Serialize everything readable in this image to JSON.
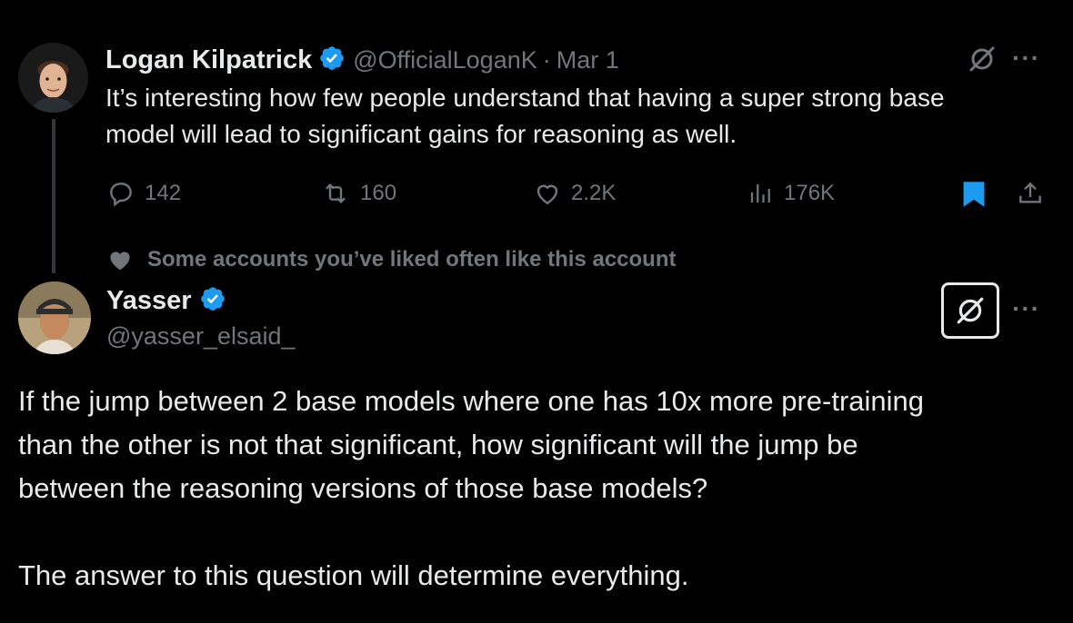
{
  "tweet": {
    "author_name": "Logan Kilpatrick",
    "handle": "@OfficialLoganK",
    "separator": "·",
    "date": "Mar 1",
    "text_line1": "It’s interesting how few people understand that having a super strong base",
    "text_line2": "model will lead to significant gains for reasoning as well.",
    "replies": "142",
    "reposts": "160",
    "likes": "2.2K",
    "views": "176K"
  },
  "social_context": "Some accounts you’ve liked often like this account",
  "reply": {
    "author_name": "Yasser",
    "handle": "@yasser_elsaid_",
    "line1": "If the jump between 2 base models where one has 10x more pre-training",
    "line2": "than the other is not that significant, how significant will the jump be",
    "line3": "between the reasoning versions of those base models?",
    "line4": "The answer to this question will determine everything."
  },
  "more_label": "···",
  "colors": {
    "background": "#000000",
    "text": "#e7e9ea",
    "muted": "#71767b",
    "accent": "#1d9bf0"
  }
}
